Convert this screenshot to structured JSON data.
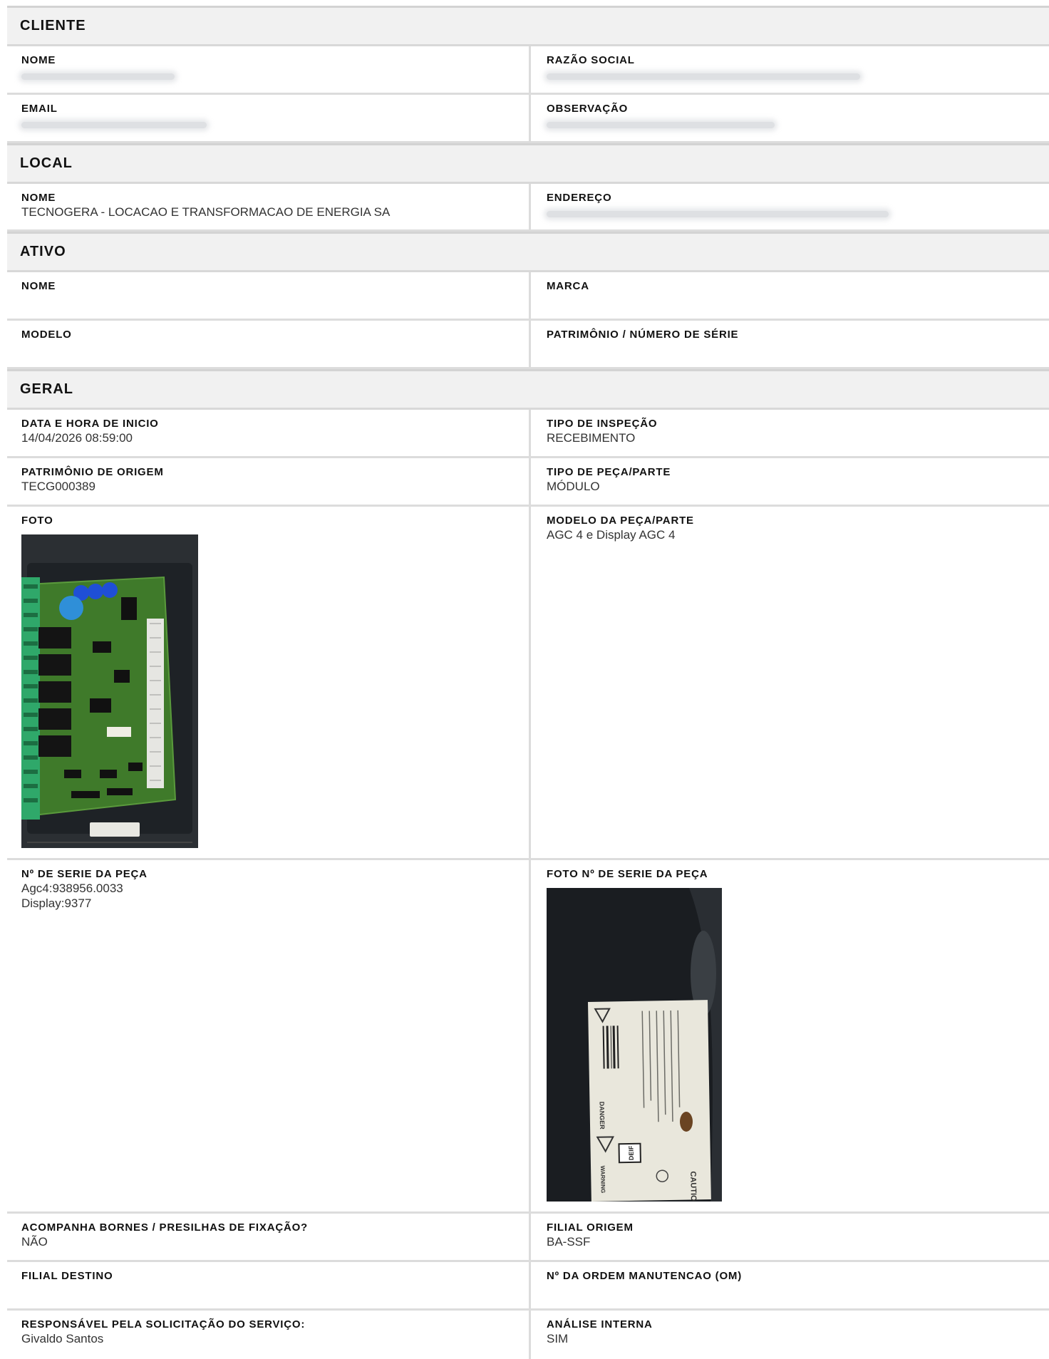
{
  "cliente": {
    "title": "CLIENTE",
    "nome_label": "NOME",
    "razao_label": "RAZÃO SOCIAL",
    "email_label": "EMAIL",
    "obs_label": "OBSERVAÇÃO"
  },
  "local": {
    "title": "LOCAL",
    "nome_label": "NOME",
    "nome_value": "TECNOGERA - LOCACAO E TRANSFORMACAO DE ENERGIA SA",
    "endereco_label": "ENDEREÇO"
  },
  "ativo": {
    "title": "ATIVO",
    "nome_label": "NOME",
    "marca_label": "MARCA",
    "modelo_label": "MODELO",
    "patrimonio_label": "PATRIMÔNIO / NÚMERO DE SÉRIE"
  },
  "geral": {
    "title": "GERAL",
    "data_label": "DATA E HORA DE INICIO",
    "data_value": "14/04/2026 08:59:00",
    "tipo_inspecao_label": "TIPO DE INSPEÇÃO",
    "tipo_inspecao_value": "RECEBIMENTO",
    "patrimonio_origem_label": "PATRIMÔNIO DE ORIGEM",
    "patrimonio_origem_value": "TECG000389",
    "tipo_peca_label": "TIPO DE PEÇA/PARTE",
    "tipo_peca_value": "MÓDULO",
    "foto_label": "FOTO",
    "modelo_peca_label": "MODELO DA PEÇA/PARTE",
    "modelo_peca_value": "AGC 4 e Display AGC 4",
    "serie_label": "Nº DE SERIE DA PEÇA",
    "serie_value": "Agc4:938956.0033\nDisplay:9377",
    "foto_serie_label": "FOTO Nº DE SERIE DA PEÇA",
    "bornes_label": "ACOMPANHA BORNES / PRESILHAS DE FIXAÇÃO?",
    "bornes_value": "NÃO",
    "filial_origem_label": "FILIAL ORIGEM",
    "filial_origem_value": "BA-SSF",
    "filial_destino_label": "FILIAL DESTINO",
    "ordem_label": "Nº DA ORDEM MANUTENCAO (OM)",
    "responsavel_label": "RESPONSÁVEL PELA SOLICITAÇÃO DO SERVIÇO:",
    "responsavel_value": "Givaldo Santos",
    "analise_label": "ANÁLISE INTERNA",
    "analise_value": "SIM"
  },
  "photo_label_text": {
    "caution": "CAUTION",
    "warning": "WARNING",
    "danger": "DANGER",
    "brand": "DEIF"
  }
}
